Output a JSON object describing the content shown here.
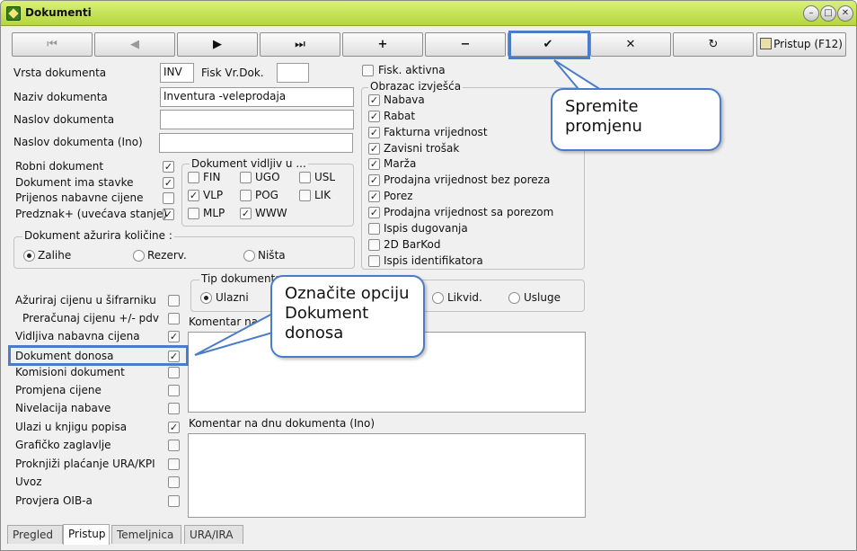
{
  "window": {
    "title": "Dokumenti"
  },
  "toolbar": {
    "first": "⏮",
    "prev": "◀",
    "next": "▶",
    "last": "⏭",
    "add": "+",
    "remove": "−",
    "confirm": "✔",
    "cancel": "✕",
    "refresh": "↻",
    "access": "Pristup (F12)"
  },
  "form": {
    "doc_type_label": "Vrsta dokumenta",
    "doc_type_value": "INV",
    "fisk_label": "Fisk Vr.Dok.",
    "fisk_value": "",
    "name_label": "Naziv dokumenta",
    "name_value": "Inventura -veleprodaja",
    "title_label": "Naslov dokumenta",
    "title_value": "",
    "title_ino_label": "Naslov dokumenta (Ino)",
    "title_ino_value": "",
    "fisk_active_label": "Fisk. aktivna"
  },
  "left_checks": [
    {
      "label": "Robni dokument",
      "checked": true
    },
    {
      "label": "Dokument ima stavke",
      "checked": true
    },
    {
      "label": "Prijenos nabavne cijene",
      "checked": false
    },
    {
      "label": "Predznak+ (uvećava stanje)",
      "checked": true
    }
  ],
  "visible_group": {
    "title": "Dokument vidljiv u ...",
    "items": [
      {
        "label": "FIN",
        "checked": false
      },
      {
        "label": "UGO",
        "checked": false
      },
      {
        "label": "USL",
        "checked": false
      },
      {
        "label": "VLP",
        "checked": true
      },
      {
        "label": "POG",
        "checked": false
      },
      {
        "label": "LIK",
        "checked": false
      },
      {
        "label": "MLP",
        "checked": false
      },
      {
        "label": "WWW",
        "checked": true
      }
    ]
  },
  "qty_group": {
    "title": "Dokument ažurira količine :",
    "options": [
      {
        "label": "Zalihe",
        "selected": true
      },
      {
        "label": "Rezerv.",
        "selected": false
      },
      {
        "label": "Ništa",
        "selected": false
      }
    ]
  },
  "report_group": {
    "title": "Obrazac izvješća",
    "items": [
      {
        "label": "Nabava",
        "checked": true
      },
      {
        "label": "Rabat",
        "checked": true
      },
      {
        "label": "Fakturna vrijednost",
        "checked": true
      },
      {
        "label": "Zavisni trošak",
        "checked": true
      },
      {
        "label": "Marža",
        "checked": true
      },
      {
        "label": "Prodajna vrijednost bez poreza",
        "checked": true
      },
      {
        "label": "Porez",
        "checked": true
      },
      {
        "label": "Prodajna vrijednost sa porezom",
        "checked": true
      },
      {
        "label": "Ispis dugovanja",
        "checked": false
      },
      {
        "label": "2D BarKod",
        "checked": false
      },
      {
        "label": "Ispis identifikatora",
        "checked": false
      }
    ]
  },
  "doc_type_group": {
    "title": "Tip dokumenta",
    "options": [
      {
        "label": "Ulazni",
        "selected": true
      },
      {
        "label": "Likvid.",
        "selected": false
      },
      {
        "label": "Usluge",
        "selected": false
      }
    ]
  },
  "lower_checks": [
    {
      "label": "Ažuriraj cijenu u šifrarniku",
      "checked": false
    },
    {
      "label": "Preračunaj cijenu +/- pdv",
      "checked": false
    },
    {
      "label": "Vidljiva nabavna cijena",
      "checked": true
    },
    {
      "label": "Dokument donosa",
      "checked": true
    },
    {
      "label": "Komisioni dokument",
      "checked": false
    },
    {
      "label": "Promjena cijene",
      "checked": false
    },
    {
      "label": "Nivelacija nabave",
      "checked": false
    },
    {
      "label": "Ulazi u knjigu popisa",
      "checked": true
    },
    {
      "label": "Grafičko zaglavlje",
      "checked": false
    },
    {
      "label": "Proknjiži plaćanje URA/KPI",
      "checked": false
    },
    {
      "label": "Uvoz",
      "checked": false
    },
    {
      "label": "Provjera OIB-a",
      "checked": false
    }
  ],
  "comments": {
    "top_label": "Komentar na d",
    "bottom_label": "Komentar na dnu dokumenta (Ino)"
  },
  "tabs": [
    {
      "label": "Pregled",
      "active": false
    },
    {
      "label": "Pristup",
      "active": true
    },
    {
      "label": "Temeljnica",
      "active": false
    },
    {
      "label": "URA/IRA",
      "active": false
    }
  ],
  "callouts": {
    "save": "Spremite promjenu",
    "mark": "Označite opciju Dokument donosa"
  },
  "colors": {
    "titlebar": "#c2e04f",
    "highlight": "#4a7cc9"
  }
}
